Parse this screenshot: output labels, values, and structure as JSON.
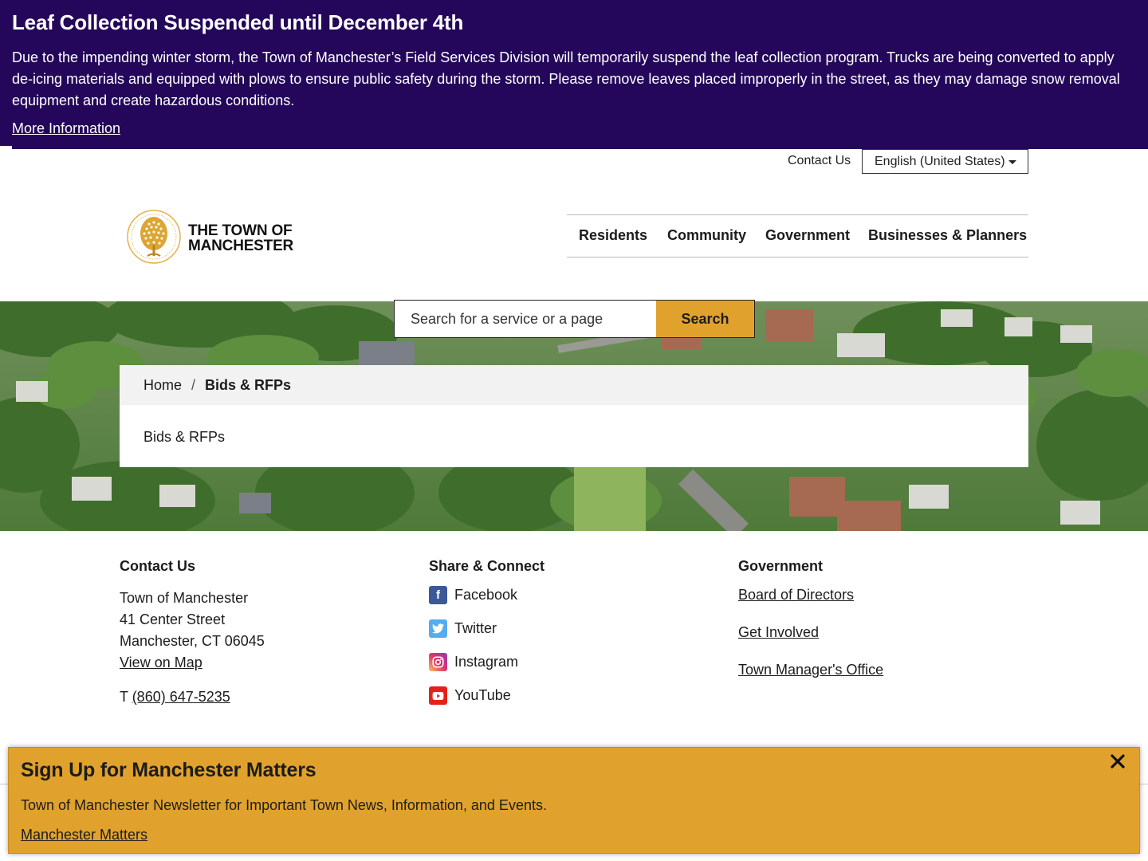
{
  "alert": {
    "title": "Leaf Collection Suspended until December 4th",
    "body": "Due to the impending winter storm, the Town of Manchester’s Field Services Division will temporarily suspend the leaf collection program. Trucks are being converted to apply de-icing materials and equipped with plows to ensure public safety during the storm. Please remove leaves placed improperly in the street, as they may damage snow removal equipment and create hazardous conditions.",
    "link": "More Information"
  },
  "utility": {
    "contact": "Contact Us",
    "language": "English (United States)"
  },
  "header": {
    "logo_line1": "THE TOWN OF",
    "logo_line2": "MANCHESTER",
    "nav": [
      "Residents",
      "Community",
      "Government",
      "Businesses & Planners"
    ]
  },
  "search": {
    "placeholder": "Search for a service or a page",
    "button": "Search"
  },
  "breadcrumb": {
    "home": "Home",
    "separator": "/",
    "current": "Bids & RFPs"
  },
  "page": {
    "body": "Bids & RFPs"
  },
  "footer": {
    "contact": {
      "heading": "Contact Us",
      "name": "Town of Manchester",
      "street": "41 Center Street",
      "city": "Manchester, CT 06045",
      "map_link": "View on Map",
      "phone_prefix": "T",
      "phone": "(860) 647-5235"
    },
    "social": {
      "heading": "Share & Connect",
      "items": [
        "Facebook",
        "Twitter",
        "Instagram",
        "YouTube"
      ]
    },
    "government": {
      "heading": "Government",
      "links": [
        "Board of Directors",
        "Get Involved",
        "Town Manager's Office"
      ]
    }
  },
  "popup": {
    "title": "Sign Up for Manchester Matters",
    "body": "Town of Manchester Newsletter for Important Town News, Information, and Events.",
    "link": "Manchester Matters"
  },
  "colors": {
    "alert_bg": "#24075a",
    "accent_gold": "#e0a22d",
    "facebook": "#3b5998",
    "twitter": "#55acee",
    "instagram": "#d6249f",
    "youtube": "#e62117"
  },
  "icons": [
    "caret-down-icon",
    "town-seal-logo",
    "facebook-icon",
    "twitter-icon",
    "instagram-icon",
    "youtube-icon",
    "close-icon"
  ]
}
